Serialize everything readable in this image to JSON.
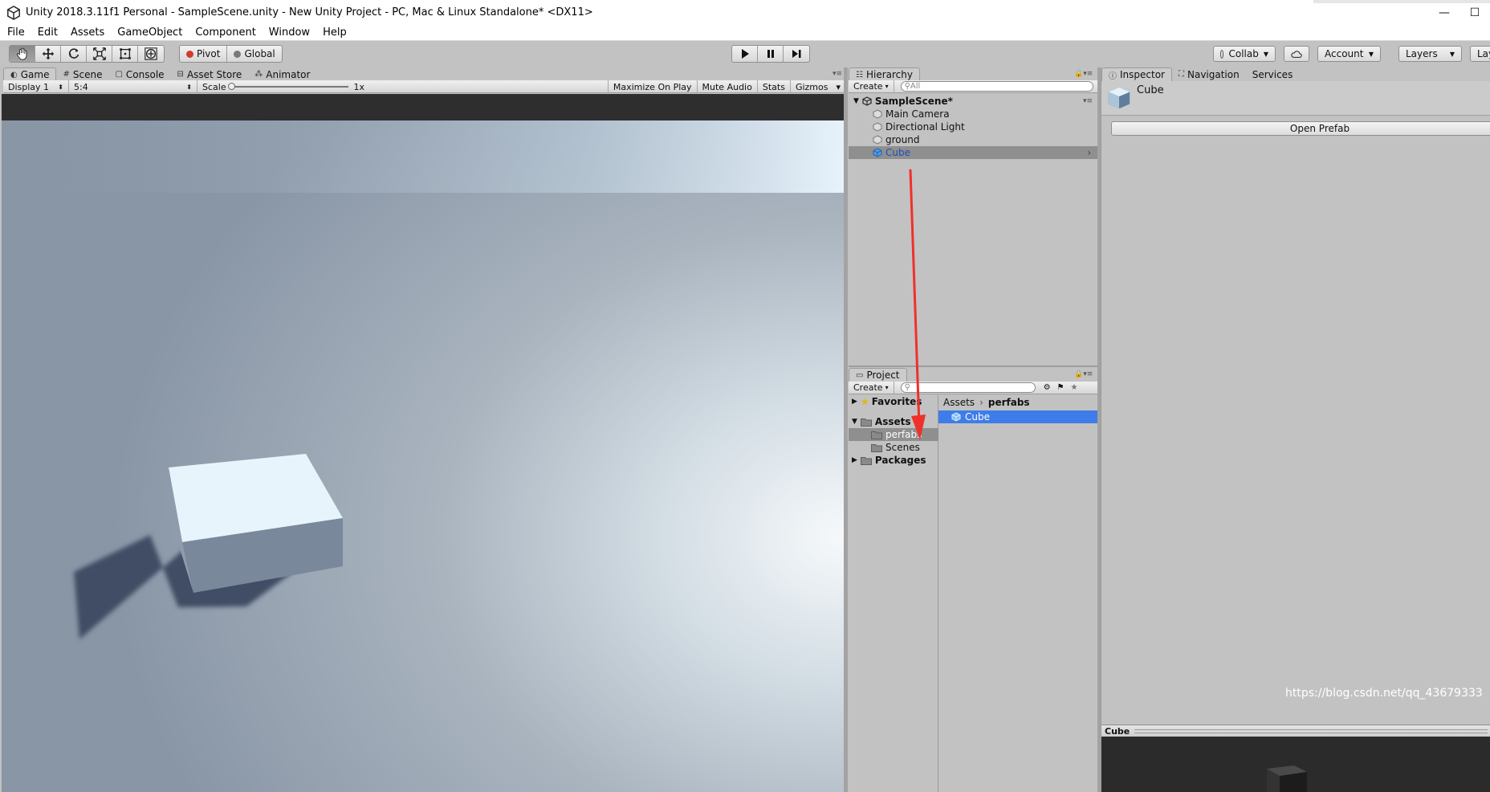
{
  "window": {
    "title": "Unity 2018.3.11f1 Personal - SampleScene.unity - New Unity Project - PC, Mac & Linux Standalone* <DX11>",
    "minimize": "—",
    "maximize": "☐"
  },
  "menu": [
    "File",
    "Edit",
    "Assets",
    "GameObject",
    "Component",
    "Window",
    "Help"
  ],
  "toolbar": {
    "pivot": "Pivot",
    "global": "Global",
    "collab": "Collab",
    "account": "Account",
    "layers": "Layers",
    "layout": "Lay"
  },
  "game_view": {
    "tabs": [
      "Game",
      "Scene",
      "Console",
      "Asset Store",
      "Animator"
    ],
    "display": "Display 1",
    "aspect": "5:4",
    "scale_label": "Scale",
    "scale_value": "1x",
    "maximize_on_play": "Maximize On Play",
    "mute_audio": "Mute Audio",
    "stats": "Stats",
    "gizmos": "Gizmos"
  },
  "hierarchy": {
    "tab": "Hierarchy",
    "create": "Create",
    "search_placeholder": "All",
    "scene": "SampleScene*",
    "items": [
      "Main Camera",
      "Directional Light",
      "ground",
      "Cube"
    ],
    "selected": "Cube"
  },
  "project": {
    "tab": "Project",
    "create": "Create",
    "favorites": "Favorites",
    "assets": "Assets",
    "folders": [
      "perfabs",
      "Scenes"
    ],
    "packages": "Packages",
    "breadcrumb": [
      "Assets",
      "perfabs"
    ],
    "selected_asset": "Cube"
  },
  "inspector": {
    "tabs": [
      "Inspector",
      "Navigation",
      "Services"
    ],
    "object_name": "Cube",
    "open_prefab": "Open Prefab",
    "preview_title": "Cube",
    "watermark": "https://blog.csdn.net/qq_43679333"
  },
  "colors": {
    "selection_blue": "#3e7de9",
    "arrow_red": "#f0302b",
    "editor_gray": "#c2c2c2"
  }
}
